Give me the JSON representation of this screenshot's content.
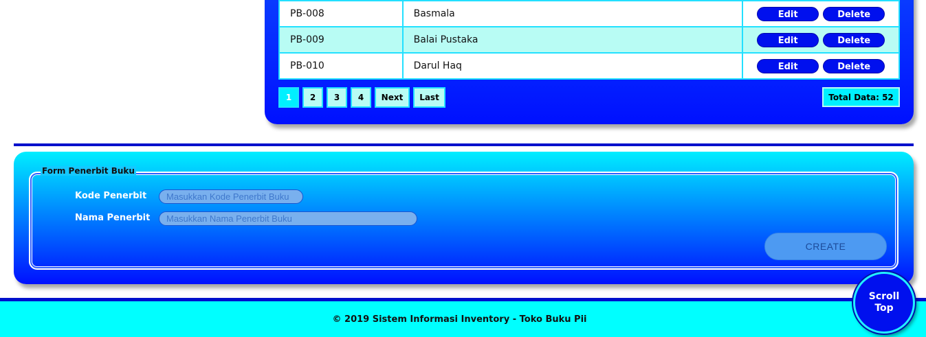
{
  "table": {
    "rows": [
      {
        "kode": "PB-008",
        "nama": "Basmala"
      },
      {
        "kode": "PB-009",
        "nama": "Balai Pustaka"
      },
      {
        "kode": "PB-010",
        "nama": "Darul Haq"
      }
    ],
    "edit_label": "Edit",
    "delete_label": "Delete"
  },
  "pagination": {
    "pages": [
      "1",
      "2",
      "3",
      "4"
    ],
    "active_page": "1",
    "next_label": "Next",
    "last_label": "Last"
  },
  "total_data": "Total Data: 52",
  "form": {
    "legend": "Form Penerbit Buku",
    "kode_label": "Kode Penerbit",
    "kode_placeholder": "Masukkan Kode Penerbit Buku",
    "kode_value": "",
    "nama_label": "Nama Penerbit",
    "nama_placeholder": "Masukkan Nama Penerbit Buku",
    "nama_value": "",
    "create_label": "CREATE"
  },
  "footer": {
    "copyright": "© 2019 Sistem Informasi Inventory - Toko Buku Pii"
  },
  "scroll_top": {
    "line1": "Scroll",
    "line2": "Top"
  },
  "colors": {
    "primary_blue": "#0010ff",
    "cyan": "#00ffff",
    "row_alt": "#b8fcf4",
    "table_border": "#22e0ff"
  }
}
